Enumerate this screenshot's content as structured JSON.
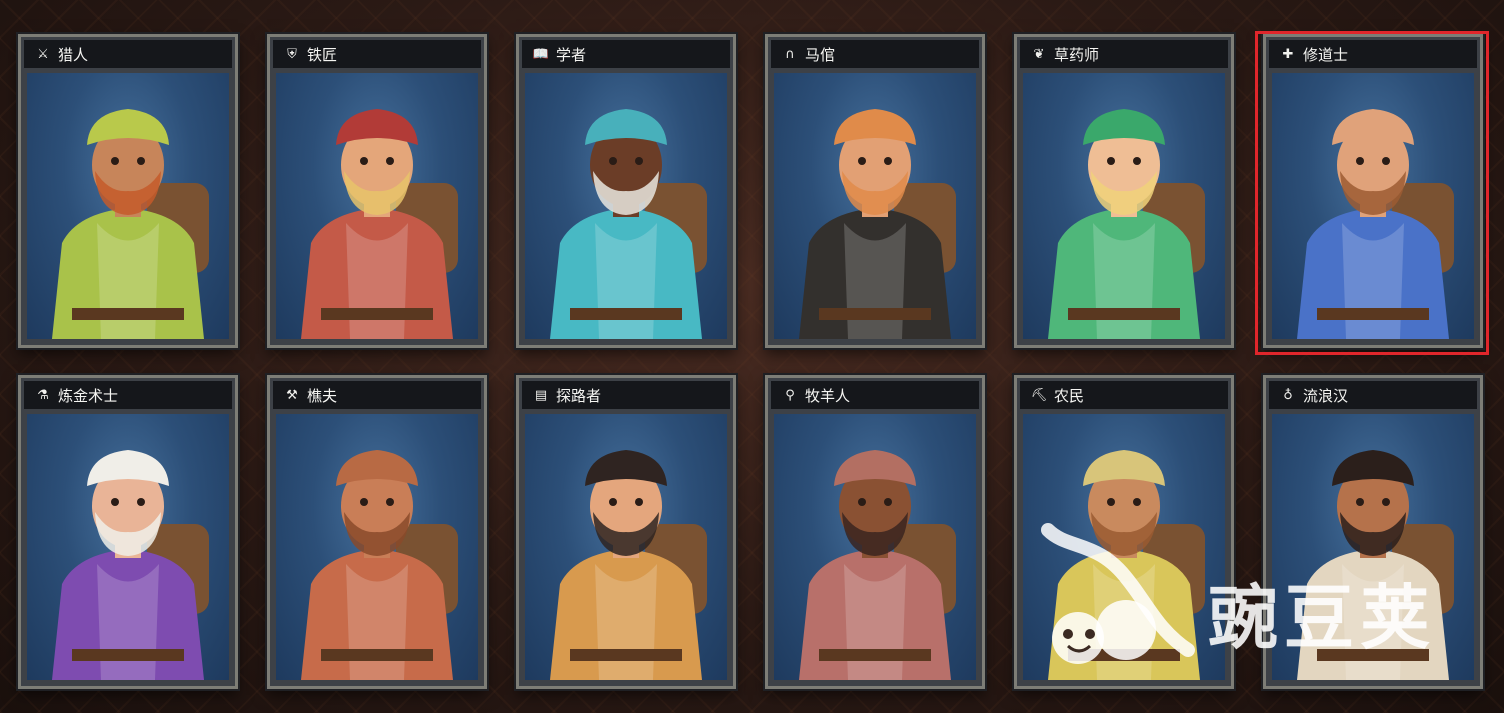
{
  "cards": [
    {
      "id": "hunter",
      "name": "猎人",
      "icon": "crossed-weapons-icon",
      "glyph": "⚔",
      "skin": "#c7855a",
      "shirt": "#a9c24a",
      "hat": "#b9c94b",
      "hair": "#c45a2a"
    },
    {
      "id": "blacksmith",
      "name": "铁匠",
      "icon": "shield-icon",
      "glyph": "⛨",
      "skin": "#e4a67a",
      "shirt": "#c45a48",
      "hat": "#b23b37",
      "hair": "#e7c36a"
    },
    {
      "id": "scholar",
      "name": "学者",
      "icon": "book-icon",
      "glyph": "📖",
      "skin": "#6b3d27",
      "shirt": "#48b9c4",
      "hat": "#48b0bb",
      "hair": "#e9e6df"
    },
    {
      "id": "stablehand",
      "name": "马倌",
      "icon": "horseshoe-icon",
      "glyph": "∩",
      "skin": "#e2a074",
      "shirt": "#33302d",
      "hat": "#e08b4a",
      "hair": "#e08b4a"
    },
    {
      "id": "herbalist",
      "name": "草药师",
      "icon": "leaf-icon",
      "glyph": "❦",
      "skin": "#efbe95",
      "shirt": "#4fb77a",
      "hat": "#3aa86b",
      "hair": "#f0d27a"
    },
    {
      "id": "monk",
      "name": "修道士",
      "icon": "cross-icon",
      "glyph": "✚",
      "skin": "#e0a27a",
      "shirt": "#4a72c8",
      "hat": "#e0a27a",
      "hair": "#9c5c33"
    },
    {
      "id": "alchemist",
      "name": "炼金术士",
      "icon": "flask-icon",
      "glyph": "⚗",
      "skin": "#e9b497",
      "shirt": "#7e4cb0",
      "hat": "#f0eee8",
      "hair": "#f0eee8"
    },
    {
      "id": "woodcutter",
      "name": "樵夫",
      "icon": "axe-icon",
      "glyph": "⚒",
      "skin": "#c97e57",
      "shirt": "#c76b4a",
      "hat": "#b86a44",
      "hair": "#8a4a2a"
    },
    {
      "id": "pathfinder",
      "name": "探路者",
      "icon": "map-icon",
      "glyph": "▤",
      "skin": "#e4a67d",
      "shirt": "#d89a4e",
      "hat": "#2f2421",
      "hair": "#2f2421"
    },
    {
      "id": "shepherd",
      "name": "牧羊人",
      "icon": "crook-icon",
      "glyph": "⚲",
      "skin": "#8a5133",
      "shirt": "#b8706a",
      "hat": "#b36f62",
      "hair": "#3a2520"
    },
    {
      "id": "farmer",
      "name": "农民",
      "icon": "hoe-icon",
      "glyph": "⛏",
      "skin": "#c98a5e",
      "shirt": "#d9c65a",
      "hat": "#d8c57a",
      "hair": "#9a5b31"
    },
    {
      "id": "vagrant",
      "name": "流浪汉",
      "icon": "pouch-icon",
      "glyph": "♁",
      "skin": "#b5724b",
      "shirt": "#e3d6c0",
      "hat": "#2b1f1b",
      "hair": "#2b1f1b"
    }
  ],
  "selected": "monk",
  "selection_color": "#e0262b",
  "watermark": {
    "text": "豌豆荚",
    "icon": "pea-pod-logo"
  }
}
